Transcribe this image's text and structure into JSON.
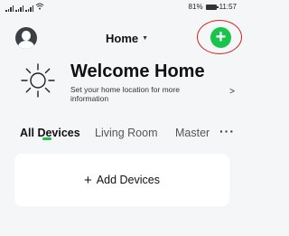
{
  "status_bar": {
    "battery": "81%",
    "time": "11:57"
  },
  "header": {
    "home_name": "Home",
    "add_symbol": "+"
  },
  "welcome": {
    "title": "Welcome Home",
    "subtitle": "Set your home location for more information",
    "arrow": ">"
  },
  "tabs": [
    {
      "label": "All Devices",
      "active": true
    },
    {
      "label": "Living Room",
      "active": false
    },
    {
      "label": "Master",
      "active": false
    }
  ],
  "tabs_more": "···",
  "devices": {
    "add_symbol": "+",
    "add_label": "Add Devices"
  },
  "colors": {
    "accent": "#19c34c",
    "background": "#f5f6f8",
    "highlight": "#d02020"
  }
}
